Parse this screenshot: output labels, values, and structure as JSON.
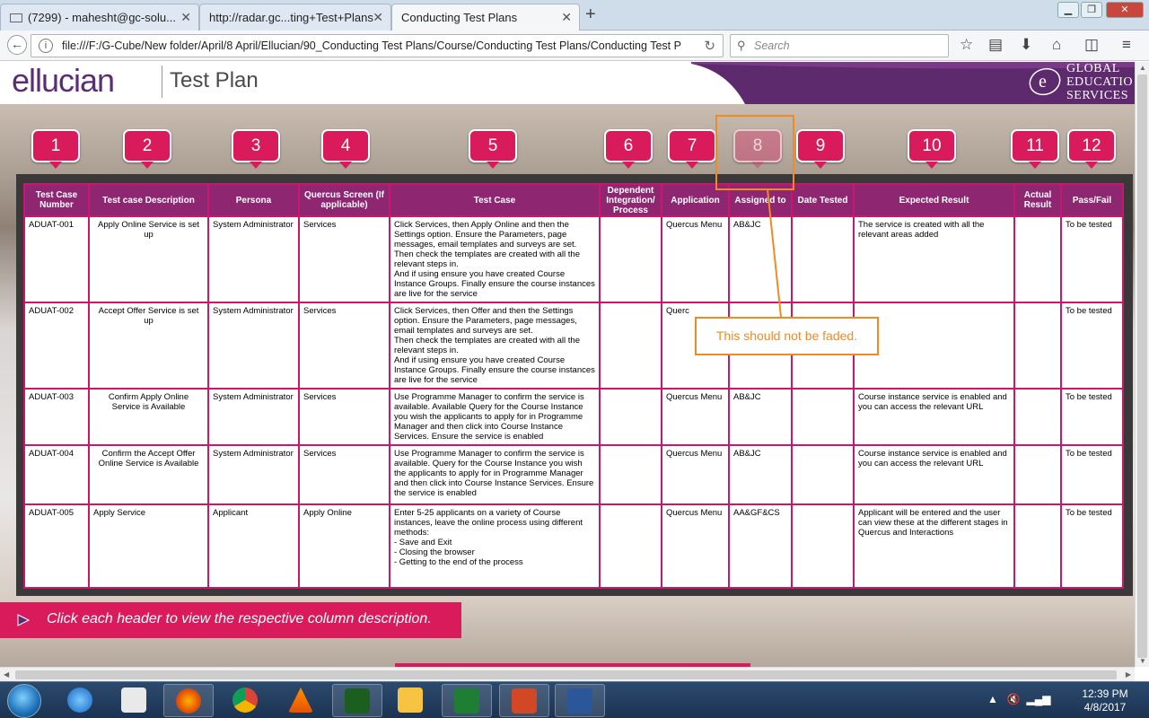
{
  "browser": {
    "tabs": [
      {
        "label": "(7299) - mahesht@gc-solu...",
        "active": false
      },
      {
        "label": "http://radar.gc...ting+Test+Plans",
        "active": false
      },
      {
        "label": "Conducting Test Plans",
        "active": true
      }
    ],
    "url": "file:///F:/G-Cube/New folder/April/8 April/Ellucian/90_Conducting Test Plans/Course/Conducting Test Plans/Conducting Test P",
    "search_placeholder": "Search"
  },
  "header": {
    "logo": "ellucian",
    "title": "Test Plan",
    "ges_lines": [
      "GLOBAL",
      "EDUCATIO",
      "SERVICES"
    ]
  },
  "badges": [
    "1",
    "2",
    "3",
    "4",
    "5",
    "6",
    "7",
    "8",
    "9",
    "10",
    "11",
    "12"
  ],
  "table": {
    "columns": [
      "Test Case Number",
      "Test case Description",
      "Persona",
      "Quercus Screen (If applicable)",
      "Test Case",
      "Dependent Integration/ Process",
      "Application",
      "Assigned to",
      "Date Tested",
      "Expected Result",
      "Actual Result",
      "Pass/Fail"
    ],
    "rows": [
      [
        "ADUAT-001",
        "Apply Online Service is set up",
        "System Administrator",
        "Services",
        "Click Services, then Apply Online and then the Settings option. Ensure the Parameters, page messages, email templates and surveys are set. Then check the templates are created with all the relevant steps in.\nAnd if using ensure you have created Course Instance Groups. Finally ensure the course instances are live for the service",
        "",
        "Quercus Menu",
        "AB&JC",
        "",
        "The service is created with all the relevant areas added",
        "",
        "To be tested"
      ],
      [
        "ADUAT-002",
        "Accept Offer Service is set up",
        "System Administrator",
        "Services",
        "Click Services, then Offer and then the Settings option. Ensure the Parameters, page messages, email templates and surveys are set.\nThen check the templates are created with all the relevant steps in.\nAnd if using ensure you have created Course Instance Groups. Finally ensure the course instances are live for the service",
        "",
        "Querc",
        "",
        "",
        "",
        "",
        "To be tested"
      ],
      [
        "ADUAT-003",
        "Confirm Apply Online Service is Available",
        "System Administrator",
        "Services",
        "Use Programme Manager to confirm the service is available. Available Query for the Course Instance you wish the applicants to apply for in Programme Manager and then click into Course Instance Services. Ensure the service is enabled",
        "",
        "Quercus Menu",
        "AB&JC",
        "",
        "Course instance service is enabled and you can access the relevant URL",
        "",
        "To be tested"
      ],
      [
        "ADUAT-004",
        "Confirm the Accept Offer Online Service is Available",
        "System Administrator",
        "Services",
        "Use Programme Manager to confirm the service is available. Query for the Course Instance you wish the applicants to apply for in Programme Manager and then click into Course Instance Services. Ensure the service is enabled",
        "",
        "Quercus Menu",
        "AB&JC",
        "",
        "Course instance service is enabled and you can access the relevant URL",
        "",
        "To be tested"
      ],
      [
        "ADUAT-005",
        "Apply Service",
        "Applicant",
        "Apply Online",
        "Enter 5-25 applicants on a variety of Course instances, leave the online process using different methods:\n- Save and Exit\n- Closing the browser\n- Getting to the end of the process",
        "",
        "Quercus Menu",
        "AA&GF&CS",
        "",
        "Applicant will be entered and the user can view these at the different stages in Quercus and Interactions",
        "",
        "To be tested"
      ]
    ]
  },
  "annotation": {
    "callout_text": "This should not be faded."
  },
  "instruction": "Click each header to view the respective column description.",
  "taskbar": {
    "time": "12:39 PM",
    "date": "4/8/2017"
  },
  "colors": {
    "accent": "#d91b5c",
    "header_purple": "#8f2672",
    "border_pink": "#c8186e",
    "annotation": "#f08a24"
  }
}
